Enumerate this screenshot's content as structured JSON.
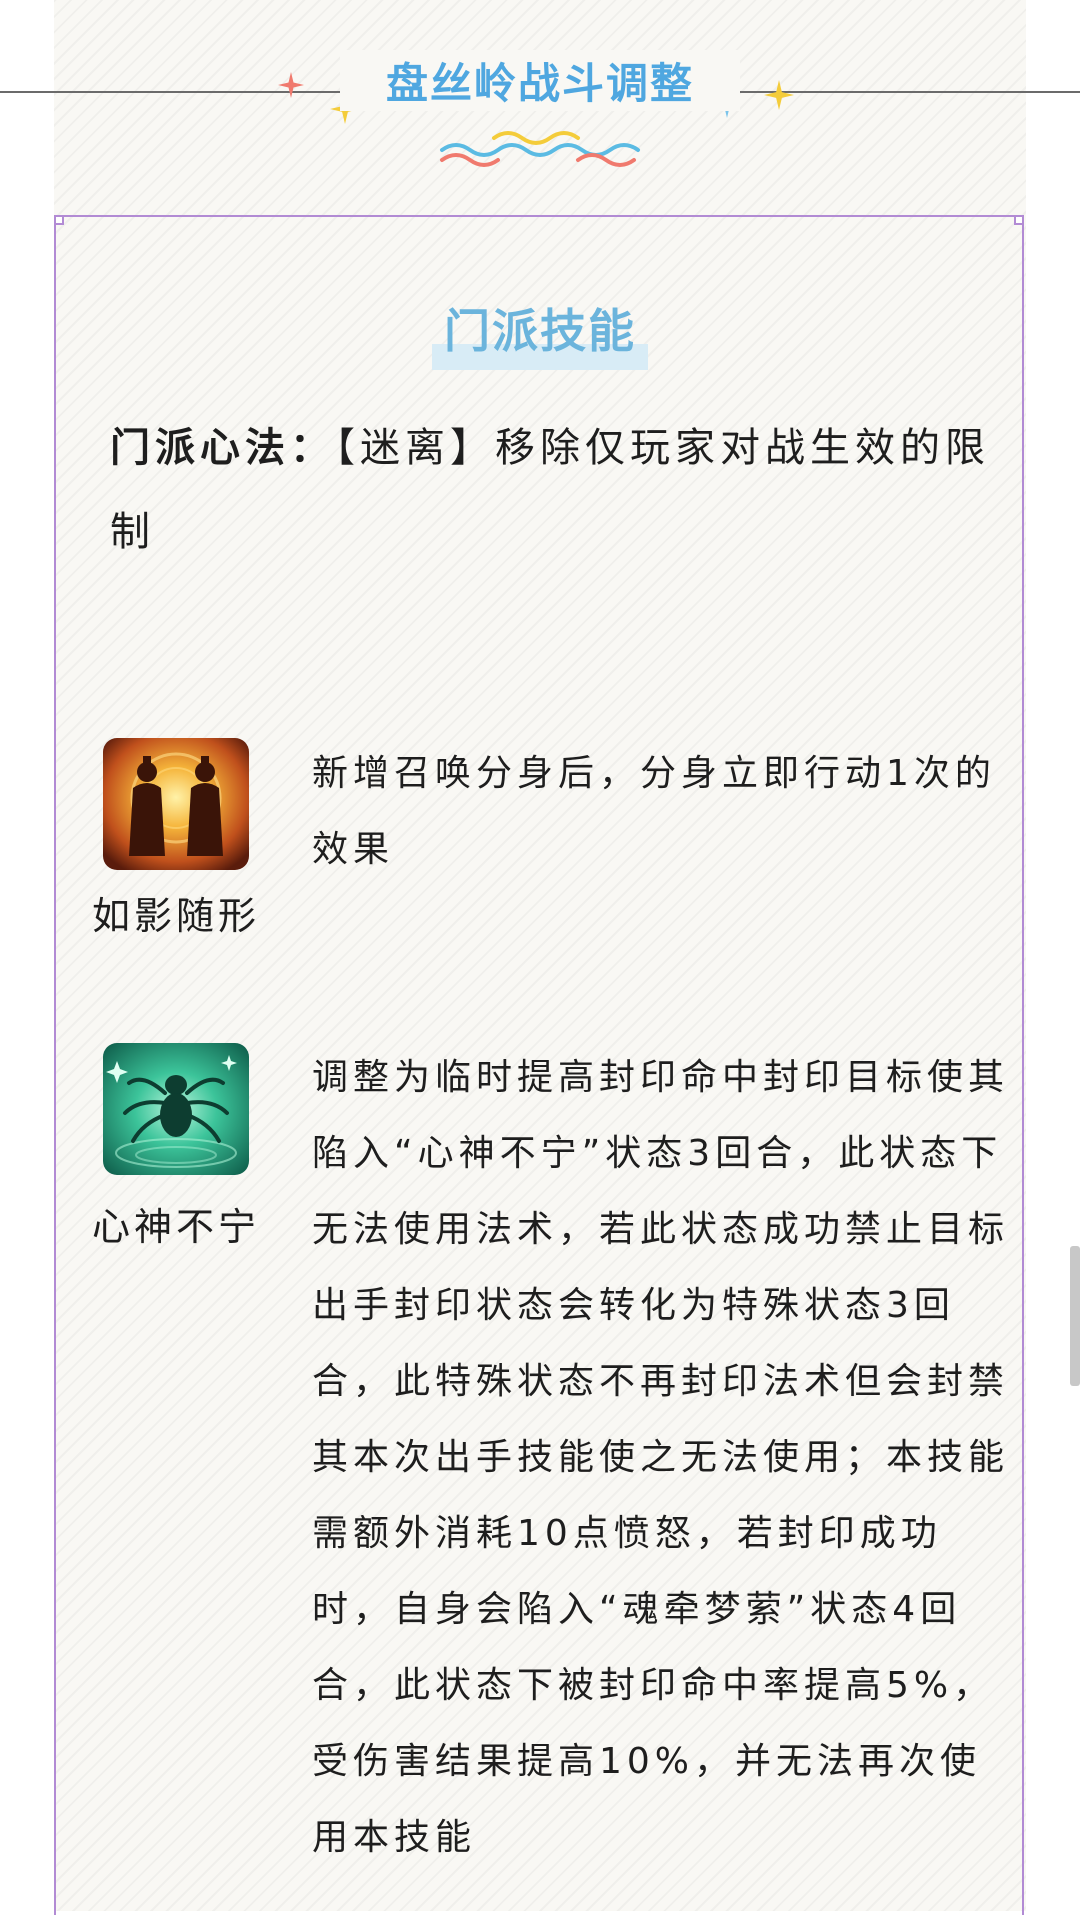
{
  "header": {
    "title": "盘丝岭战斗调整"
  },
  "section": {
    "heading": "门派技能"
  },
  "intro": {
    "label": "门派心法：",
    "text": "【迷离】移除仅玩家对战生效的限制"
  },
  "skills": [
    {
      "name": "如影随形",
      "icon": "twin-silhouette-icon",
      "description": "新增召唤分身后，分身立即行动1次的效果"
    },
    {
      "name": "心神不宁",
      "icon": "spider-icon",
      "description": "调整为临时提高封印命中封印目标使其陷入“心神不宁”状态3回合，此状态下无法使用法术，若此状态成功禁止目标出手封印状态会转化为特殊状态3回合，此特殊状态不再封印法术但会封禁其本次出手技能使之无法使用；本技能需额外消耗10点愤怒，若封印成功时，自身会陷入“魂牵梦萦”状态4回合，此状态下被封印命中率提高5%，受伤害结果提高10%，并无法再次使用本技能"
    }
  ],
  "colors": {
    "title": "#4fa7e0",
    "frame": "#b28bd4",
    "heading": "#6bb4dc"
  }
}
